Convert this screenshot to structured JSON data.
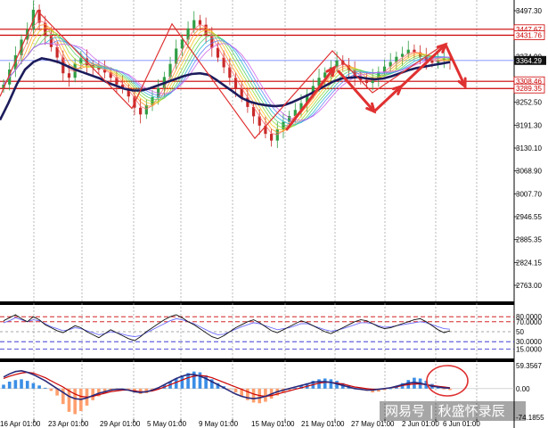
{
  "colors": {
    "background": "#ffffff",
    "grid": "#9a9a9a",
    "bull_candle": "#2f9e44",
    "bear_candle": "#c92a2a",
    "ma_main": "#1c1c5c",
    "horizontal_line": "#cc0000",
    "current_price_line": "#7a8cff",
    "price_tag": "#111111",
    "zigzag": "#e03131",
    "arrow": "#e03131",
    "oscillator_line_1": "#111111",
    "oscillator_line_2": "#6c6cff",
    "oscillator_level_high": "#cc0000",
    "oscillator_level_low": "#2020cc",
    "histogram_pos": "#3b8ee6",
    "histogram_neg": "#ff9f6e",
    "signal_line": "#cc0000",
    "macd_line": "#2a2a7a",
    "annotation_circle": "#e03131"
  },
  "chart_data": [
    {
      "type": "candlestick",
      "title": "",
      "y_ticks": [
        "3497.30",
        "3436.05",
        "3374.90",
        "3313.75",
        "3252.50",
        "3191.30",
        "3130.10",
        "3068.90",
        "3007.70",
        "2946.55",
        "2885.35",
        "2824.15",
        "2763.00"
      ],
      "ylim": [
        2763.0,
        3497.3
      ],
      "x_ticks": [
        "16 Apr 01:00",
        "23 Apr 01:00",
        "29 Apr 01:00",
        "5 May 01:00",
        "9 May 01:00",
        "15 May 01:00",
        "21 May 01:00",
        "27 May 01:00",
        "2 Jun 01:00",
        "6 Jun 01:00"
      ],
      "close_series": [
        3300,
        3340,
        3378,
        3420,
        3447,
        3500,
        3465,
        3430,
        3400,
        3372,
        3330,
        3318,
        3356,
        3370,
        3352,
        3345,
        3340,
        3332,
        3318,
        3300,
        3288,
        3268,
        3238,
        3220,
        3245,
        3266,
        3290,
        3320,
        3355,
        3396,
        3420,
        3450,
        3472,
        3460,
        3430,
        3398,
        3372,
        3346,
        3318,
        3290,
        3265,
        3240,
        3215,
        3190,
        3168,
        3150,
        3180,
        3200,
        3216,
        3232,
        3250,
        3274,
        3296,
        3318,
        3332,
        3346,
        3364,
        3352,
        3338,
        3320,
        3312,
        3304,
        3318,
        3334,
        3348,
        3360,
        3374,
        3382,
        3393,
        3386,
        3374,
        3364,
        3358,
        3364,
        3370,
        3364
      ],
      "moving_average": [
        3205,
        3250,
        3300,
        3340,
        3360,
        3370,
        3366,
        3360,
        3350,
        3340,
        3332,
        3324,
        3316,
        3304,
        3296,
        3288,
        3284,
        3284,
        3290,
        3298,
        3306,
        3314,
        3322,
        3328,
        3330,
        3326,
        3312,
        3296,
        3280,
        3264,
        3254,
        3248,
        3244,
        3242,
        3244,
        3252,
        3262,
        3272,
        3284,
        3296,
        3308,
        3316,
        3318,
        3320,
        3316,
        3314,
        3316,
        3322,
        3330,
        3338,
        3344,
        3348,
        3352,
        3356,
        3360
      ],
      "horizontal_levels": [
        {
          "label": "3447.67",
          "value": 3447.67
        },
        {
          "label": "3431.76",
          "value": 3431.76
        },
        {
          "label": "3308.46",
          "value": 3308.46
        },
        {
          "label": "3289.35",
          "value": 3289.35
        }
      ],
      "current_price": {
        "label": "3364.29",
        "value": 3364.29
      },
      "zigzag": [
        3268,
        3497,
        3236,
        3462,
        3156,
        3390,
        3278,
        3410
      ],
      "annotation_arrows": [
        "up",
        "down",
        "up",
        "up",
        "down"
      ]
    },
    {
      "type": "line",
      "name": "oscillator",
      "y_ticks": [
        "80.0000",
        "70.0000",
        "50",
        "30.0000",
        "15.0000"
      ],
      "levels": [
        80,
        70,
        50,
        30,
        15
      ],
      "ylim": [
        0,
        100
      ],
      "line_1": [
        72,
        78,
        84,
        76,
        70,
        80,
        74,
        64,
        58,
        52,
        48,
        55,
        62,
        58,
        50,
        44,
        38,
        46,
        54,
        48,
        42,
        36,
        32,
        40,
        50,
        58,
        66,
        74,
        80,
        84,
        78,
        70,
        64,
        56,
        48,
        40,
        36,
        42,
        50,
        58,
        64,
        70,
        74,
        68,
        60,
        52,
        48,
        54,
        60,
        66,
        72,
        68,
        62,
        56,
        50,
        46,
        52,
        58,
        64,
        70,
        74,
        72,
        66,
        60,
        56,
        58,
        62,
        66,
        70,
        74,
        76,
        70,
        62,
        54,
        48,
        52
      ],
      "line_2": [
        68,
        72,
        78,
        74,
        70,
        74,
        72,
        66,
        60,
        56,
        52,
        54,
        58,
        56,
        52,
        48,
        44,
        46,
        50,
        48,
        45,
        42,
        40,
        42,
        48,
        54,
        60,
        66,
        72,
        76,
        74,
        70,
        66,
        60,
        54,
        48,
        44,
        45,
        50,
        55,
        60,
        64,
        68,
        66,
        62,
        58,
        54,
        56,
        58,
        62,
        66,
        66,
        62,
        58,
        54,
        51,
        53,
        56,
        60,
        64,
        68,
        68,
        66,
        62,
        59,
        60,
        62,
        64,
        66,
        68,
        70,
        68,
        64,
        60,
        56,
        55
      ]
    },
    {
      "type": "bar",
      "name": "histogram-oscillator",
      "y_ticks": [
        "59.3567",
        "0.00",
        "-74.1855"
      ],
      "ylim": [
        -74.1855,
        59.3567
      ],
      "histogram": [
        10,
        18,
        22,
        24,
        20,
        14,
        8,
        2,
        -6,
        -18,
        -40,
        -60,
        -66,
        -58,
        -44,
        -30,
        -20,
        -12,
        -6,
        -2,
        0,
        -4,
        -10,
        -14,
        -12,
        -6,
        2,
        10,
        18,
        26,
        34,
        40,
        44,
        42,
        34,
        24,
        14,
        6,
        -2,
        -10,
        -20,
        -30,
        -36,
        -38,
        -34,
        -26,
        -18,
        -10,
        -4,
        2,
        8,
        14,
        20,
        24,
        26,
        24,
        20,
        14,
        8,
        2,
        -2,
        -6,
        -10,
        -8,
        -4,
        0,
        6,
        14,
        22,
        28,
        26,
        20,
        12,
        4,
        -2,
        -4
      ],
      "signal_line": [
        26,
        32,
        36,
        40,
        42,
        40,
        34,
        28,
        20,
        12,
        4,
        -6,
        -14,
        -20,
        -22,
        -20,
        -16,
        -12,
        -8,
        -6,
        -4,
        -4,
        -6,
        -8,
        -8,
        -6,
        -2,
        4,
        10,
        16,
        22,
        28,
        32,
        34,
        32,
        28,
        22,
        16,
        10,
        4,
        -2,
        -8,
        -14,
        -18,
        -20,
        -18,
        -14,
        -10,
        -6,
        -2,
        2,
        6,
        10,
        14,
        16,
        16,
        14,
        12,
        8,
        4,
        2,
        0,
        -2,
        -2,
        0,
        2,
        4,
        8,
        10,
        12,
        12,
        10,
        8,
        6,
        4,
        2
      ],
      "macd_line": [
        30,
        38,
        44,
        46,
        42,
        36,
        28,
        20,
        10,
        0,
        -10,
        -20,
        -26,
        -28,
        -24,
        -18,
        -12,
        -8,
        -4,
        -2,
        -2,
        -4,
        -8,
        -10,
        -8,
        -4,
        2,
        10,
        18,
        26,
        32,
        36,
        36,
        32,
        26,
        18,
        10,
        2,
        -6,
        -14,
        -20,
        -24,
        -26,
        -24,
        -20,
        -14,
        -8,
        -4,
        0,
        4,
        8,
        12,
        16,
        18,
        18,
        16,
        12,
        8,
        4,
        0,
        -2,
        -4,
        -4,
        -2,
        0,
        2,
        6,
        10,
        14,
        16,
        14,
        10,
        6,
        4,
        2,
        1
      ]
    }
  ],
  "watermark": {
    "text": "网易号 | 秋盛怀录辰"
  }
}
